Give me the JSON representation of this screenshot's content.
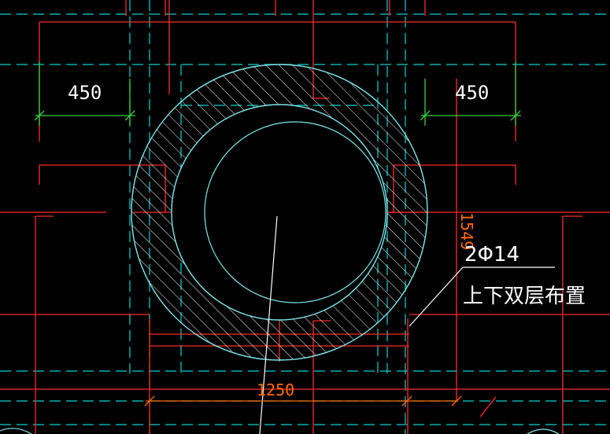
{
  "drawing": {
    "dims": {
      "left_width": "450",
      "right_width": "450",
      "bottom_width": "1250",
      "right_vertical": "1549"
    },
    "rebar_note": {
      "line1": "2Φ14",
      "line2": "上下双层布置"
    },
    "colors": {
      "background": "#000000",
      "wall_lines": "#ff2a2a",
      "grid_lines": "#00d4d4",
      "hatch_ring": "#7fe9ee",
      "dimension_lines": "#39d339",
      "dimension_text_red": "#ff6a00",
      "text_white": "#ffffff"
    }
  }
}
